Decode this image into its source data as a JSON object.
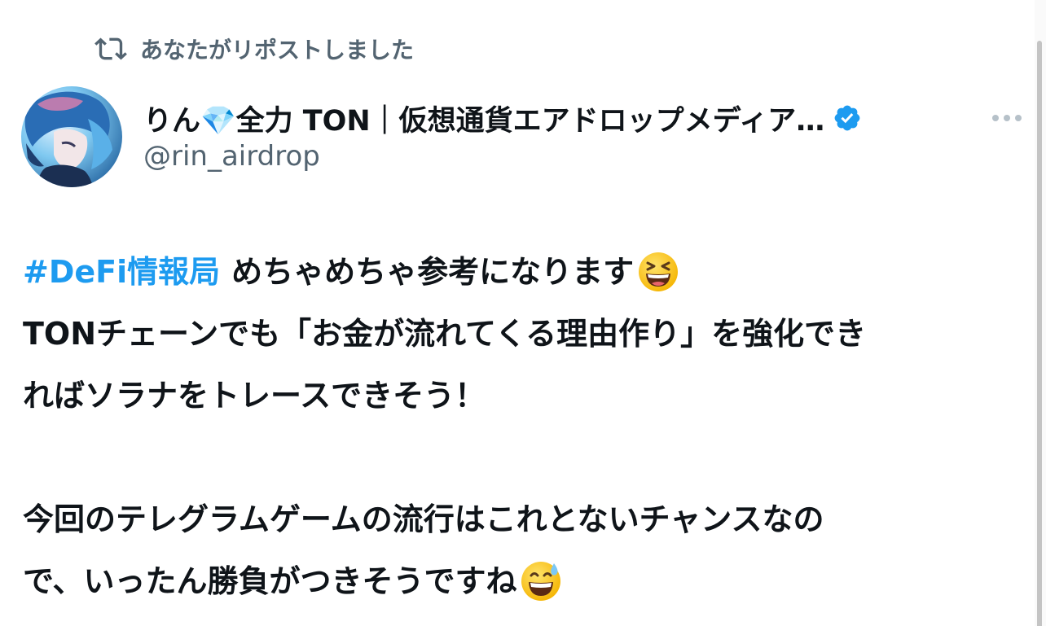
{
  "repost": {
    "icon": "repost-icon",
    "text": "あなたがリポストしました"
  },
  "author": {
    "avatar_icon": "avatar-image",
    "display_name": "りん💎全力 TON｜仮想通貨エアドロップメディア…",
    "verified_icon": "verified-badge-icon",
    "handle": "@rin_airdrop"
  },
  "more_icon": "more-options-icon",
  "post": {
    "hashtag": "#DeFi情報局",
    "line1_text": "めちゃめちゃ参考になります",
    "line1_emoji": "grinning-squinting-face-emoji",
    "line2": "TONチェーンでも「お金が流れてくる理由作り」を強化でき",
    "line3": "ればソラナをトレースできそう！",
    "line4": "今回のテレグラムゲームの流行はこれとないチャンスなの",
    "line5_text": "で、いったん勝負がつきそうですね",
    "line5_emoji": "grinning-face-with-sweat-emoji"
  },
  "colors": {
    "text": "#0f1419",
    "secondary": "#536471",
    "accent": "#1d9bf0",
    "background": "#ffffff"
  }
}
